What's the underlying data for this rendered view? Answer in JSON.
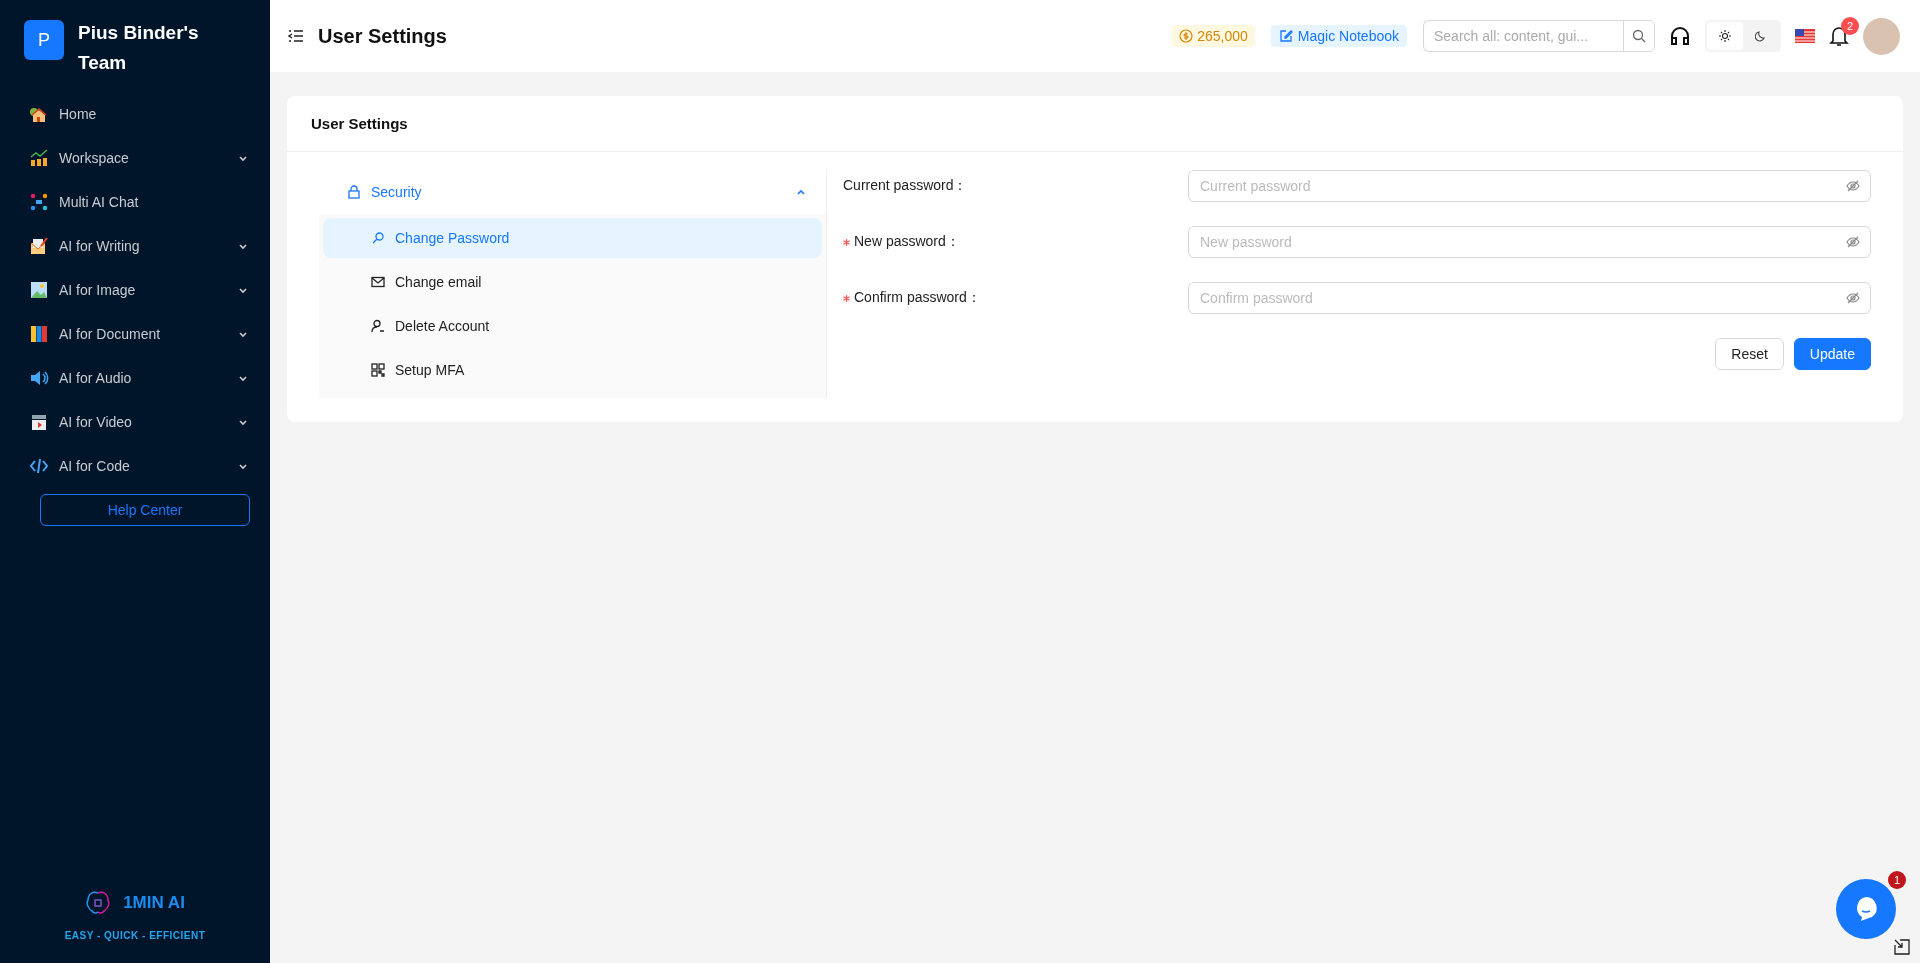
{
  "sidebar": {
    "team_initial": "P",
    "team_name": "Pius Binder's Team",
    "items": [
      {
        "label": "Home",
        "kind": "link"
      },
      {
        "label": "Workspace",
        "kind": "group"
      },
      {
        "label": "Multi AI Chat",
        "kind": "link"
      },
      {
        "label": "AI for Writing",
        "kind": "group"
      },
      {
        "label": "AI for Image",
        "kind": "group"
      },
      {
        "label": "AI for Document",
        "kind": "group"
      },
      {
        "label": "AI for Audio",
        "kind": "group"
      },
      {
        "label": "AI for Video",
        "kind": "group"
      },
      {
        "label": "AI for Code",
        "kind": "group"
      }
    ],
    "help_button": "Help Center",
    "brand": "1MIN AI",
    "tagline": "EASY - QUICK - EFFICIENT"
  },
  "header": {
    "title": "User Settings",
    "credits": "265,000",
    "notebook": "Magic Notebook",
    "search_placeholder": "Search all: content, gui...",
    "theme": [
      {
        "selected": true
      },
      {
        "selected": false
      }
    ],
    "notifications": "2"
  },
  "card": {
    "title": "User Settings",
    "menu": {
      "label": "Security",
      "expanded": true,
      "children": [
        {
          "label": "Change Password",
          "selected": true
        },
        {
          "label": "Change email",
          "selected": false
        },
        {
          "label": "Delete Account",
          "selected": false
        },
        {
          "label": "Setup MFA",
          "selected": false
        }
      ]
    },
    "fields": [
      {
        "label": "Current password：",
        "required": false,
        "placeholder": "Current password"
      },
      {
        "label": "New password：",
        "required": true,
        "placeholder": "New password"
      },
      {
        "label": "Confirm password：",
        "required": true,
        "placeholder": "Confirm password"
      }
    ],
    "buttons": [
      {
        "label": "Reset",
        "kind": "default"
      },
      {
        "label": "Update",
        "kind": "primary"
      }
    ]
  },
  "chat": {
    "badge": "1"
  }
}
